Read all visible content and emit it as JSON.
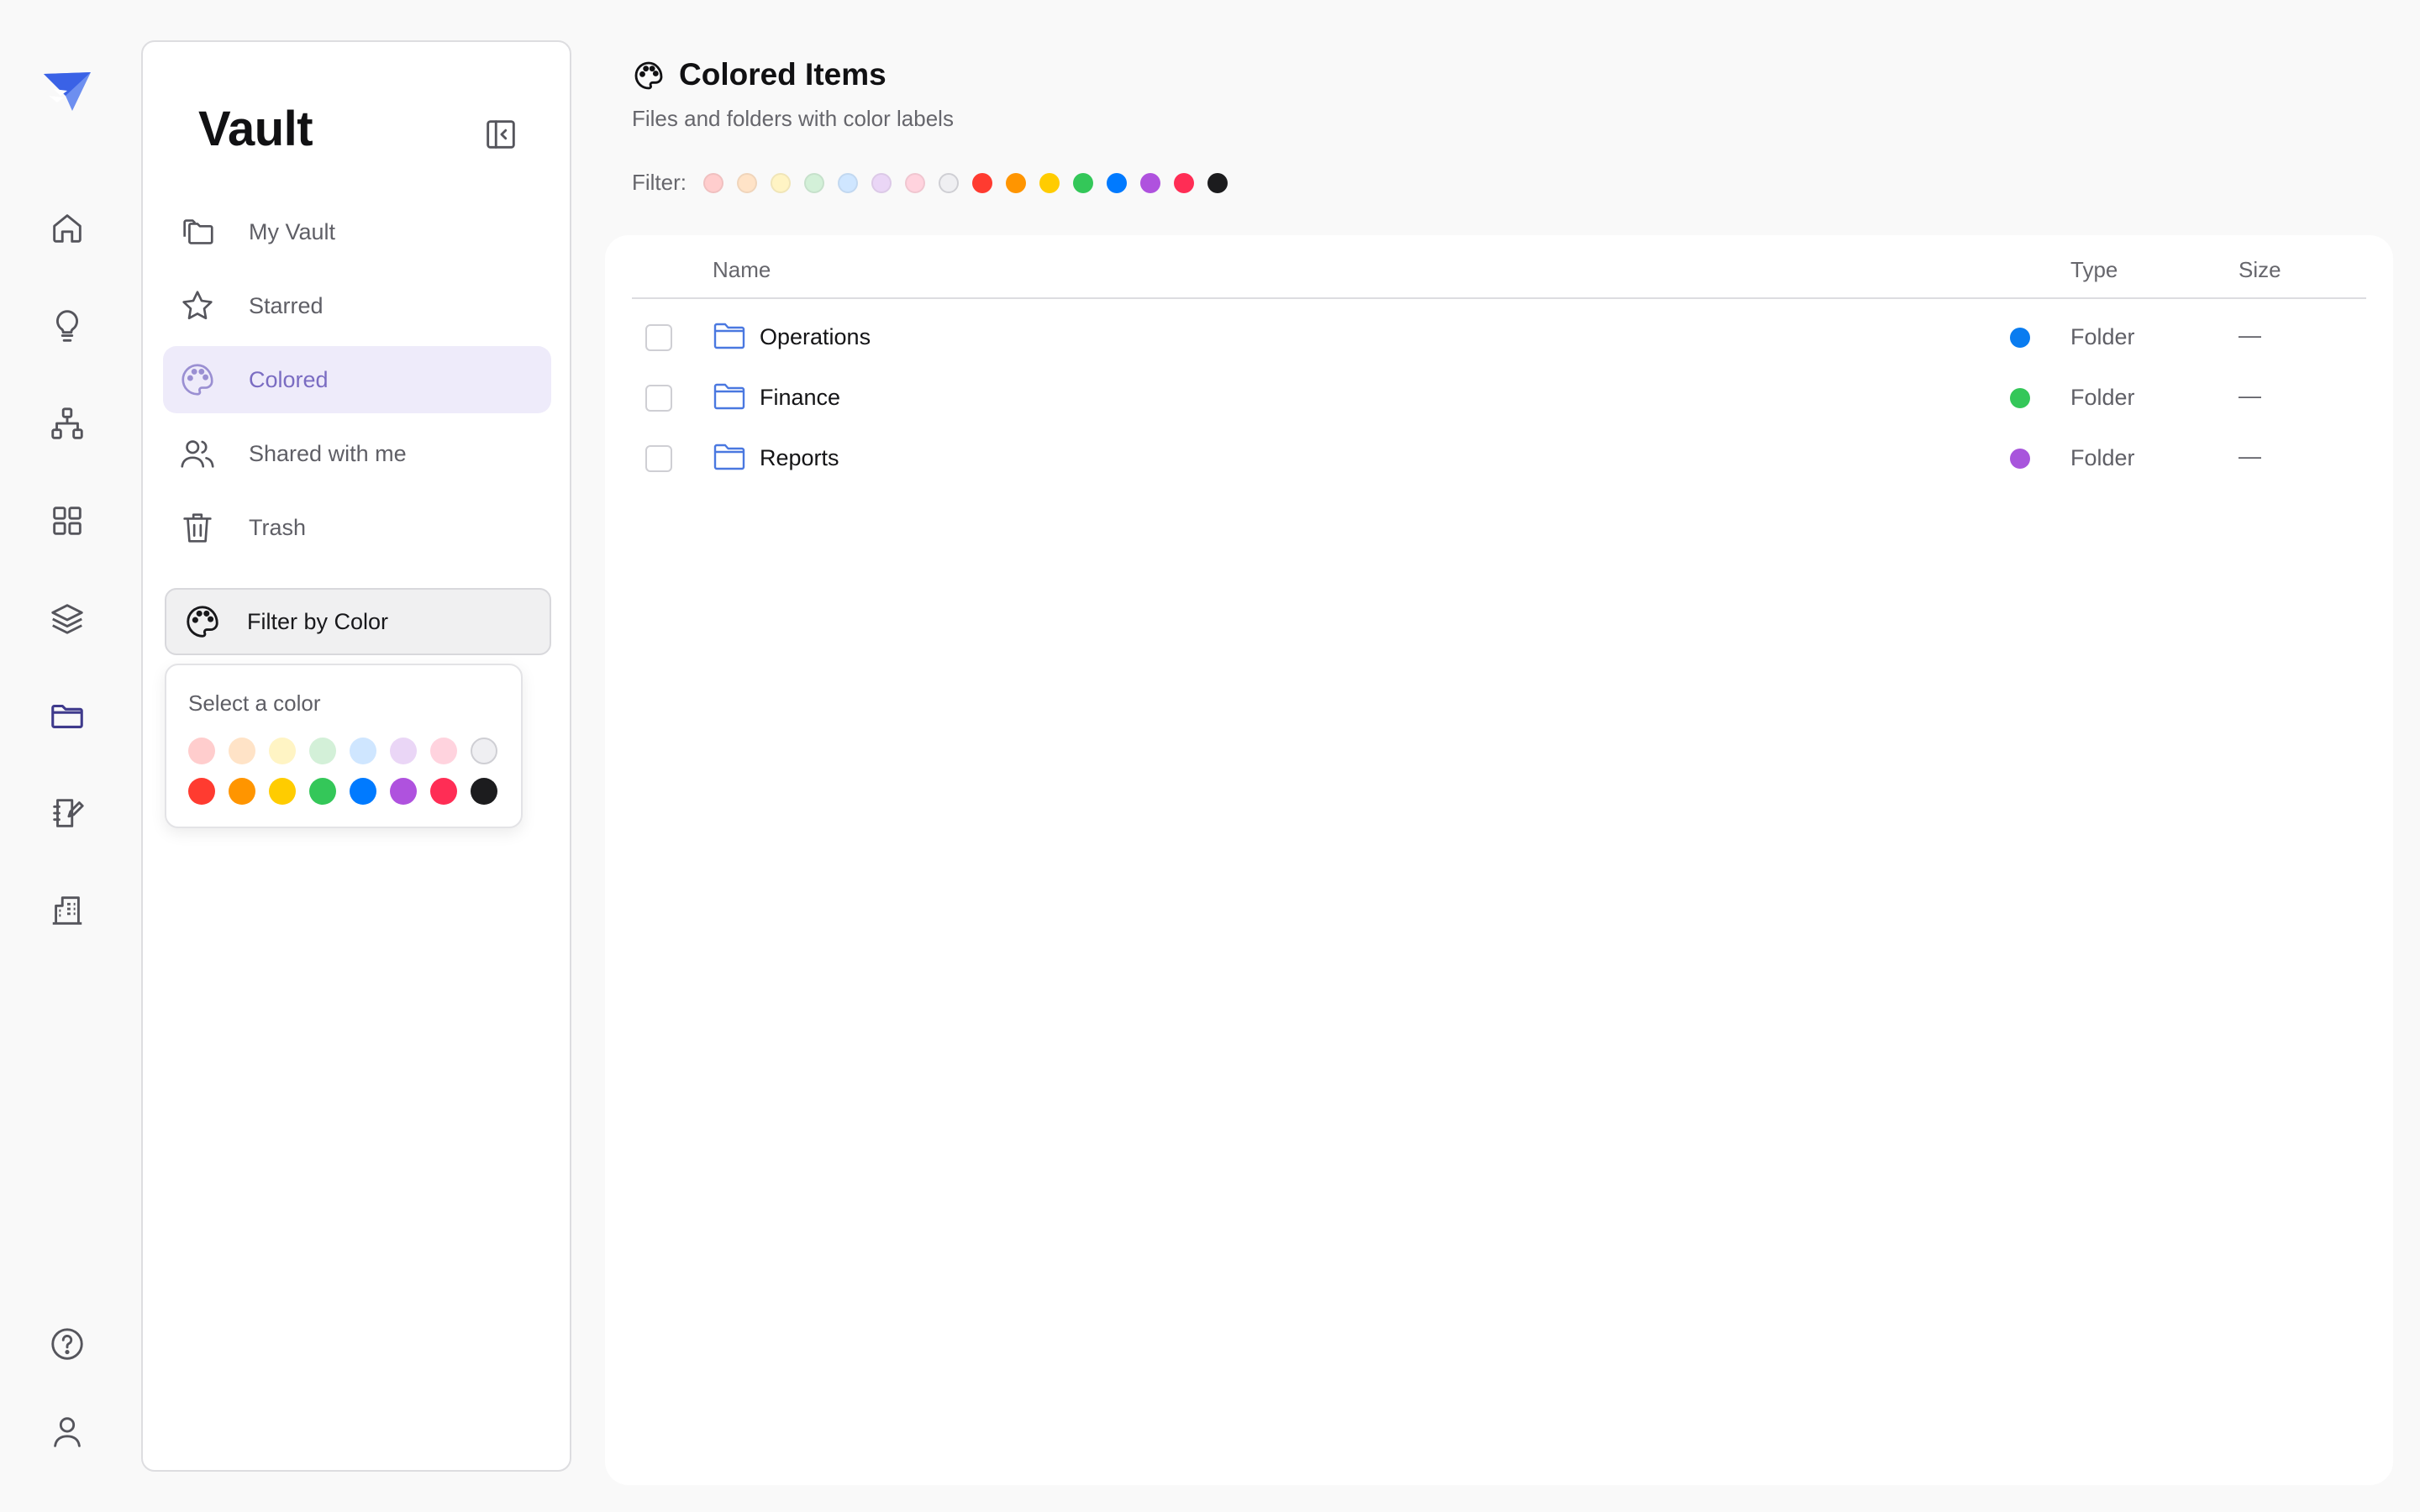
{
  "sidebar": {
    "title": "Vault",
    "nav": [
      {
        "label": "My Vault",
        "icon": "folders-icon",
        "active": false
      },
      {
        "label": "Starred",
        "icon": "star-icon",
        "active": false
      },
      {
        "label": "Colored",
        "icon": "palette-icon",
        "active": true
      },
      {
        "label": "Shared with me",
        "icon": "users-icon",
        "active": false
      },
      {
        "label": "Trash",
        "icon": "trash-icon",
        "active": false
      }
    ],
    "filter_button_label": "Filter by Color",
    "color_popover": {
      "title": "Select a color",
      "light_swatches": [
        "#ffcdcd",
        "#ffe3c7",
        "#fff4c4",
        "#d3f0d8",
        "#cfe6ff",
        "#ead6f6",
        "#ffd3de",
        "#efeff2"
      ],
      "bold_swatches": [
        "#ff3b30",
        "#ff9500",
        "#ffcc00",
        "#34c759",
        "#007aff",
        "#af52de",
        "#ff2d55",
        "#1c1c1e"
      ]
    }
  },
  "rail": {
    "logo": "paper-plane-logo",
    "items": [
      "home-icon",
      "lightbulb-icon",
      "sitemap-icon",
      "grid-icon",
      "layers-icon",
      "folder-icon",
      "notebook-icon",
      "building-icon"
    ],
    "bottom": [
      "help-icon",
      "user-icon"
    ],
    "active_item": "folder-icon"
  },
  "main": {
    "title": "Colored Items",
    "subtitle": "Files and folders with color labels",
    "filter_label": "Filter:",
    "filter_colors": [
      "#ffcdcd",
      "#ffe3c7",
      "#fff4c4",
      "#d3f0d8",
      "#cfe6ff",
      "#ead6f6",
      "#ffd3de",
      "#efeff2",
      "#ff3b30",
      "#ff9500",
      "#ffcc00",
      "#34c759",
      "#007aff",
      "#af52de",
      "#ff2d55",
      "#1c1c1e"
    ],
    "table": {
      "columns": [
        "Name",
        "Type",
        "Size"
      ],
      "rows": [
        {
          "name": "Operations",
          "color": "#0a7cf0",
          "type": "Folder",
          "size": "—"
        },
        {
          "name": "Finance",
          "color": "#34c759",
          "type": "Folder",
          "size": "—"
        },
        {
          "name": "Reports",
          "color": "#a855dc",
          "type": "Folder",
          "size": "—"
        }
      ]
    }
  },
  "colors": {
    "accent": "#7a6cc2",
    "accent_bg": "#eeebfa",
    "logo_blue": "#3a62e6",
    "folder_blue": "#4a78e0"
  }
}
